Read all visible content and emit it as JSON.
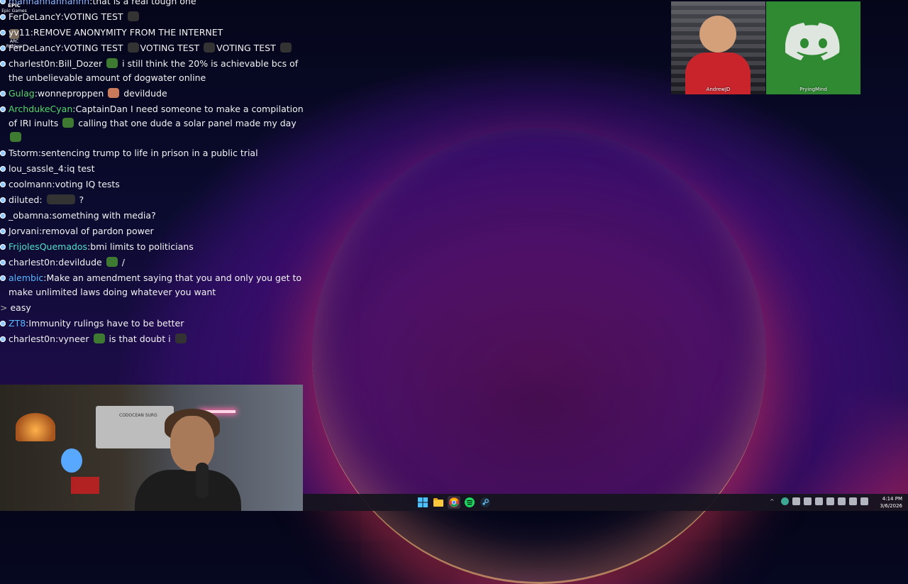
{
  "desktop_icons": [
    {
      "label": "Epic Games",
      "badge": "EPIC"
    },
    {
      "label": "ARC Raiders"
    }
  ],
  "chat": {
    "messages": [
      {
        "user": "mahnahnahnahhh",
        "user_color": "#8fb7ff",
        "text": "that is a real tough one"
      },
      {
        "user": "FerDeLancY",
        "user_color": "#ffffff",
        "text": "VOTING TEST"
      },
      {
        "user": "yv11",
        "user_color": "#ffffff",
        "text": "REMOVE ANONYMITY FROM THE INTERNET"
      },
      {
        "user": "FerDeLancY",
        "user_color": "#ffffff",
        "text": "VOTING TEST",
        "text2": "VOTING TEST",
        "text3": "VOTING",
        "text4": "TEST"
      },
      {
        "user": "charlest0n",
        "user_color": "#ffffff",
        "text": "Bill_Dozer",
        "text2": "i still think the 20% is achievable bcs of the unbelievable amount of dogwater online"
      },
      {
        "user": "Gulag",
        "user_color": "#5fd46a",
        "text": "wonneproppen",
        "text2": "devildude"
      },
      {
        "user": "ArchdukeCyan",
        "user_color": "#52d86a",
        "text": "CaptainDan I need someone to make a compilation of IRI inults",
        "text2": "calling that one dude a solar panel made my day"
      },
      {
        "user": "Tstorm",
        "user_color": "#ffffff",
        "text": "sentencing trump to life in prison in a public trial"
      },
      {
        "user": "lou_sassle_4",
        "user_color": "#ffffff",
        "text": "iq test"
      },
      {
        "user": "coolmann",
        "user_color": "#ffffff",
        "text": "voting IQ tests"
      },
      {
        "user": "diluted",
        "user_color": "#ffffff",
        "text": "?"
      },
      {
        "user": "_obamna",
        "user_color": "#ffffff",
        "text": "something with media?"
      },
      {
        "user": "Jorvani",
        "user_color": "#ffffff",
        "text": "removal of pardon power"
      },
      {
        "user": "FrijolesQuemados",
        "user_color": "#52e0c8",
        "text": "bmi limits to politicians"
      },
      {
        "user": "charlest0n",
        "user_color": "#ffffff",
        "text": "devildude",
        "text2": "/"
      },
      {
        "user": "alembic",
        "user_color": "#5ab6ff",
        "text": "Make an amendment saying that you and only you get to make unlimited laws doing whatever you want"
      },
      {
        "user": "ZT8",
        "user_color": "#5ab6ff",
        "text": "Immunity rulings have to be better"
      },
      {
        "user": "charlest0n",
        "user_color": "#ffffff",
        "text": "vyneer",
        "text2": "is that doubt i"
      }
    ],
    "reply_text": "easy"
  },
  "cams": [
    {
      "name": "AndrewJD"
    },
    {
      "name": "PryingMind"
    }
  ],
  "webcam": {
    "sign_text": "CODOCEAN SURG"
  },
  "taskbar": {
    "apps": [
      "windows-start",
      "file-explorer",
      "chrome",
      "spotify",
      "steam"
    ],
    "clock_time": "4:14 PM",
    "clock_date": "3/6/2026"
  }
}
